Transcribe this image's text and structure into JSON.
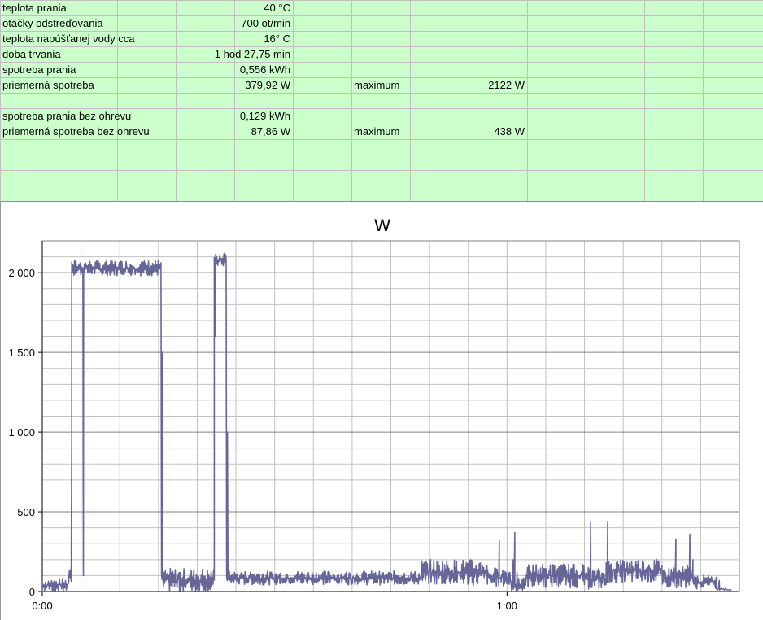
{
  "sheet": {
    "rows": [
      {
        "label": "teplota prania",
        "value": "40 °C"
      },
      {
        "label": "otáčky odstreďovania",
        "value": "700 ot/min"
      },
      {
        "label": "teplota napúšťanej vody cca",
        "value": "16° C"
      },
      {
        "label": "doba trvania",
        "value": "1 hod 27,75 min"
      },
      {
        "label": "spotreba prania",
        "value": "0,556 kWh"
      },
      {
        "label": "priemerná spotreba",
        "value": "379,92 W",
        "extra_label": "maximum",
        "extra_value": "2122 W"
      },
      {
        "label": "",
        "value": ""
      },
      {
        "label": "spotreba prania bez ohrevu",
        "value": "0,129 kWh"
      },
      {
        "label": "priemerná spotreba bez ohrevu",
        "value": "87,86 W",
        "extra_label": "maximum",
        "extra_value": "438 W"
      }
    ]
  },
  "colors": {
    "sheet_bg": "#ccffcc",
    "sheet_grid": "#c0c0c0",
    "series": "#666699",
    "gridline": "#c0c0c0",
    "major_gridline": "#808080"
  },
  "chart_data": {
    "type": "line",
    "title": "W",
    "xlabel": "",
    "ylabel": "",
    "x_unit": "minutes",
    "xlim": [
      0,
      90
    ],
    "ylim": [
      0,
      2200
    ],
    "yticks": [
      0,
      500,
      1000,
      1500,
      2000
    ],
    "ytick_labels": [
      "0",
      "500",
      "1 000",
      "1 500",
      "2 000"
    ],
    "xticks": [
      0,
      60
    ],
    "xtick_labels": [
      "0:00",
      "1:00"
    ],
    "grid": true,
    "legend": "none",
    "series": [
      {
        "segments": [
          {
            "x0": 0.0,
            "x1": 3.5,
            "base": 40,
            "noise": 40,
            "period": 0.2
          },
          {
            "x0": 3.5,
            "x1": 3.8,
            "base": 120,
            "noise": 60,
            "period": 0.15
          },
          {
            "x0": 3.8,
            "x1": 15.4,
            "base": 2030,
            "noise": 45,
            "period": 0.18
          },
          {
            "x0": 15.4,
            "x1": 22.2,
            "base": 70,
            "noise": 70,
            "period": 0.16
          },
          {
            "x0": 22.2,
            "x1": 23.8,
            "base": 2080,
            "noise": 40,
            "period": 0.18
          },
          {
            "x0": 23.8,
            "x1": 49.0,
            "base": 85,
            "noise": 40,
            "period": 0.17
          },
          {
            "x0": 49.0,
            "x1": 57.5,
            "base": 120,
            "noise": 75,
            "period": 0.14
          },
          {
            "x0": 57.5,
            "x1": 60.5,
            "base": 90,
            "noise": 55,
            "period": 0.15
          },
          {
            "x0": 60.5,
            "x1": 62.5,
            "base": 40,
            "noise": 40,
            "period": 0.2
          },
          {
            "x0": 62.5,
            "x1": 70.0,
            "base": 100,
            "noise": 70,
            "period": 0.14
          },
          {
            "x0": 70.0,
            "x1": 73.0,
            "base": 80,
            "noise": 60,
            "period": 0.15
          },
          {
            "x0": 73.0,
            "x1": 80.0,
            "base": 130,
            "noise": 70,
            "period": 0.14
          },
          {
            "x0": 80.0,
            "x1": 84.0,
            "base": 90,
            "noise": 60,
            "period": 0.15
          },
          {
            "x0": 84.0,
            "x1": 87.0,
            "base": 60,
            "noise": 40,
            "period": 0.2
          },
          {
            "x0": 87.0,
            "x1": 88.5,
            "base": 15,
            "noise": 5,
            "period": 0.3
          }
        ],
        "points": [
          [
            0.0,
            0
          ],
          [
            0.3,
            30
          ],
          [
            3.6,
            90
          ],
          [
            3.8,
            950
          ],
          [
            3.9,
            2050
          ],
          [
            5.2,
            2000
          ],
          [
            5.3,
            100
          ],
          [
            5.4,
            2020
          ],
          [
            15.3,
            2040
          ],
          [
            15.5,
            1500
          ],
          [
            15.7,
            120
          ],
          [
            22.0,
            90
          ],
          [
            22.2,
            1000
          ],
          [
            22.3,
            1600
          ],
          [
            22.5,
            2100
          ],
          [
            23.7,
            2100
          ],
          [
            23.9,
            1000
          ],
          [
            24.0,
            80
          ],
          [
            58.8,
            120
          ],
          [
            59.0,
            320
          ],
          [
            59.2,
            90
          ],
          [
            60.8,
            200
          ],
          [
            61.0,
            370
          ],
          [
            61.3,
            120
          ],
          [
            70.5,
            150
          ],
          [
            70.8,
            440
          ],
          [
            71.1,
            120
          ],
          [
            72.8,
            180
          ],
          [
            73.0,
            440
          ],
          [
            73.3,
            130
          ],
          [
            81.5,
            150
          ],
          [
            81.8,
            330
          ],
          [
            82.1,
            100
          ],
          [
            83.3,
            160
          ],
          [
            83.6,
            360
          ],
          [
            84.0,
            200
          ],
          [
            87.4,
            70
          ],
          [
            87.5,
            15
          ],
          [
            89.0,
            10
          ]
        ]
      }
    ]
  }
}
